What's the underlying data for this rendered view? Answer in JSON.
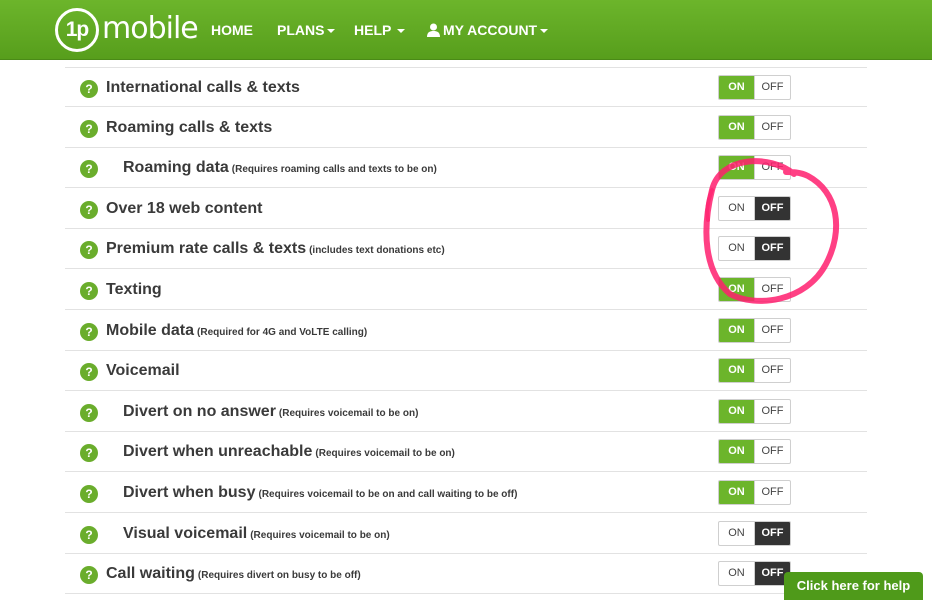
{
  "brand": {
    "logo_mark": "1p",
    "logo_word": "mobile"
  },
  "nav": {
    "home": "HOME",
    "plans": "PLANS",
    "help": "HELP",
    "account": "MY ACCOUNT"
  },
  "toggle_labels": {
    "on": "ON",
    "off": "OFF"
  },
  "settings": [
    {
      "label": "International calls & texts",
      "note": "",
      "state": "on",
      "indent": false
    },
    {
      "label": "Roaming calls & texts",
      "note": "",
      "state": "on",
      "indent": false
    },
    {
      "label": "Roaming data",
      "note": "(Requires roaming calls and texts to be on)",
      "state": "on",
      "indent": true
    },
    {
      "label": "Over 18 web content",
      "note": "",
      "state": "off",
      "indent": false
    },
    {
      "label": "Premium rate calls & texts",
      "note": "(includes text donations etc)",
      "state": "off",
      "indent": false
    },
    {
      "label": "Texting",
      "note": "",
      "state": "on",
      "indent": false
    },
    {
      "label": "Mobile data",
      "note": "(Required for 4G and VoLTE calling)",
      "state": "on",
      "indent": false
    },
    {
      "label": "Voicemail",
      "note": "",
      "state": "on",
      "indent": false
    },
    {
      "label": "Divert on no answer",
      "note": "(Requires voicemail to be on)",
      "state": "on",
      "indent": true
    },
    {
      "label": "Divert when unreachable",
      "note": "(Requires voicemail to be on)",
      "state": "on",
      "indent": true
    },
    {
      "label": "Divert when busy",
      "note": "(Requires voicemail to be on and call waiting to be off)",
      "state": "on",
      "indent": true
    },
    {
      "label": "Visual voicemail",
      "note": "(Requires voicemail to be on)",
      "state": "off",
      "indent": true
    },
    {
      "label": "Call waiting",
      "note": "(Requires divert on busy to be off)",
      "state": "off",
      "indent": false
    }
  ],
  "help_button": "Click here for help",
  "colors": {
    "brand_green": "#6cb52b",
    "off_dark": "#333333",
    "annotation_pink": "#ff1f6e"
  }
}
